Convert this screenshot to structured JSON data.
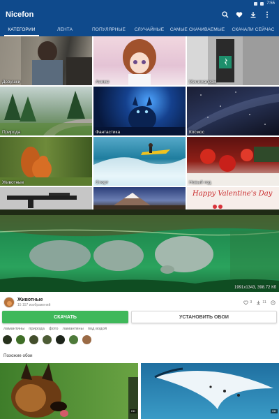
{
  "app": {
    "title": "Nicefon"
  },
  "status": {
    "time": "7:55"
  },
  "toolbar": {
    "icons": [
      "search-icon",
      "heart-icon",
      "download-icon",
      "more-vert-icon"
    ]
  },
  "tabs": [
    {
      "label": "КАТЕГОРИИ",
      "active": true
    },
    {
      "label": "ЛЕНТА",
      "active": false
    },
    {
      "label": "ПОПУЛЯРНЫЕ",
      "active": false
    },
    {
      "label": "СЛУЧАЙНЫЕ",
      "active": false
    },
    {
      "label": "САМЫЕ СКАЧИВАЕМЫЕ",
      "active": false
    },
    {
      "label": "СКАЧАЛИ СЕЙЧАС",
      "active": false
    }
  ],
  "categories": [
    {
      "label": "Девушки"
    },
    {
      "label": "Аниме"
    },
    {
      "label": "Минимализм"
    },
    {
      "label": "Природа"
    },
    {
      "label": "Фантастика"
    },
    {
      "label": "Космос"
    },
    {
      "label": "Животные"
    },
    {
      "label": "Спорт"
    },
    {
      "label": "Новый год"
    },
    {
      "label": ""
    },
    {
      "label": ""
    },
    {
      "label": "Happy Valentine's Day"
    }
  ],
  "preview": {
    "meta": "1991x1343, 398.72 Кб"
  },
  "detail": {
    "author_name": "Животные",
    "author_sub": "15 157 изображений",
    "likes": "3",
    "downloads": "11",
    "download_label": "СКАЧАТЬ",
    "set_wallpaper_label": "УСТАНОВИТЬ ОБОИ",
    "tags": [
      "ламантины",
      "природа",
      "фото",
      "ламантины",
      "под водой"
    ],
    "swatch_colors": [
      "#27311c",
      "#3f6e27",
      "#434e2c",
      "#4d5c35",
      "#1d241a",
      "#4e7a3a",
      "#9a6a45"
    ],
    "similar_title": "Похожие обои",
    "hd_label": "HD"
  },
  "colors": {
    "appbar": "#0f4a8c",
    "download_button": "#3fb85a"
  }
}
